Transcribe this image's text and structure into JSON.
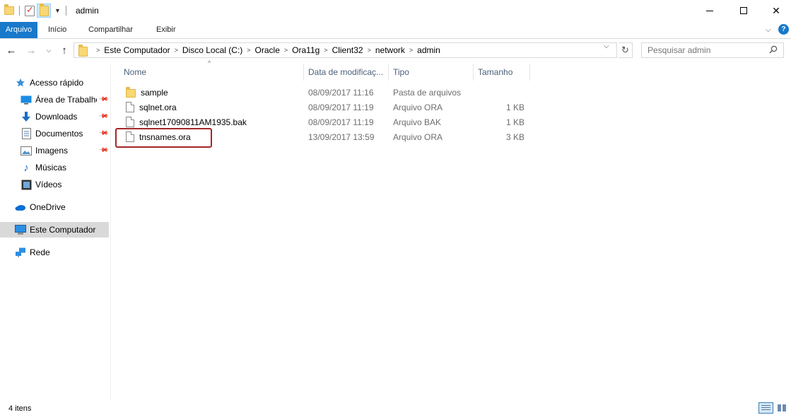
{
  "window": {
    "title": "admin",
    "minimize_icon": "minimize-icon",
    "maximize_icon": "maximize-icon",
    "close_label": "✕"
  },
  "ribbon": {
    "tabs": [
      {
        "label": "Arquivo",
        "active": true
      },
      {
        "label": "Início",
        "active": false
      },
      {
        "label": "Compartilhar",
        "active": false
      },
      {
        "label": "Exibir",
        "active": false
      }
    ],
    "help_label": "?"
  },
  "nav": {
    "breadcrumb": [
      "Este Computador",
      "Disco Local (C:)",
      "Oracle",
      "Ora11g",
      "Client32",
      "network",
      "admin"
    ],
    "search_placeholder": "Pesquisar admin"
  },
  "sidebar": {
    "items": [
      {
        "label": "Acesso rápido",
        "icon": "star-icon",
        "pinned": false
      },
      {
        "label": "Área de Trabalho",
        "icon": "desktop-icon",
        "pinned": true
      },
      {
        "label": "Downloads",
        "icon": "download-icon",
        "pinned": true
      },
      {
        "label": "Documentos",
        "icon": "documents-icon",
        "pinned": true
      },
      {
        "label": "Imagens",
        "icon": "pictures-icon",
        "pinned": true
      },
      {
        "label": "Músicas",
        "icon": "music-icon",
        "pinned": false
      },
      {
        "label": "Vídeos",
        "icon": "videos-icon",
        "pinned": false
      },
      {
        "label": "OneDrive",
        "icon": "onedrive-icon",
        "pinned": false
      },
      {
        "label": "Este Computador",
        "icon": "computer-icon",
        "pinned": false,
        "selected": true
      },
      {
        "label": "Rede",
        "icon": "network-icon",
        "pinned": false
      }
    ]
  },
  "columns": {
    "name": "Nome",
    "date": "Data de modificaç...",
    "type": "Tipo",
    "size": "Tamanho"
  },
  "files": [
    {
      "name": "sample",
      "date": "08/09/2017 11:16",
      "type": "Pasta de arquivos",
      "size": "",
      "kind": "folder"
    },
    {
      "name": "sqlnet.ora",
      "date": "08/09/2017 11:19",
      "type": "Arquivo ORA",
      "size": "1 KB",
      "kind": "file"
    },
    {
      "name": "sqlnet17090811AM1935.bak",
      "date": "08/09/2017 11:19",
      "type": "Arquivo BAK",
      "size": "1 KB",
      "kind": "file"
    },
    {
      "name": "tnsnames.ora",
      "date": "13/09/2017 13:59",
      "type": "Arquivo ORA",
      "size": "3 KB",
      "kind": "file",
      "highlighted": true
    }
  ],
  "status": {
    "item_count": "4 itens"
  },
  "colors": {
    "accent": "#1979ca",
    "highlight_border": "#a3262a",
    "folder": "#f8d775"
  }
}
